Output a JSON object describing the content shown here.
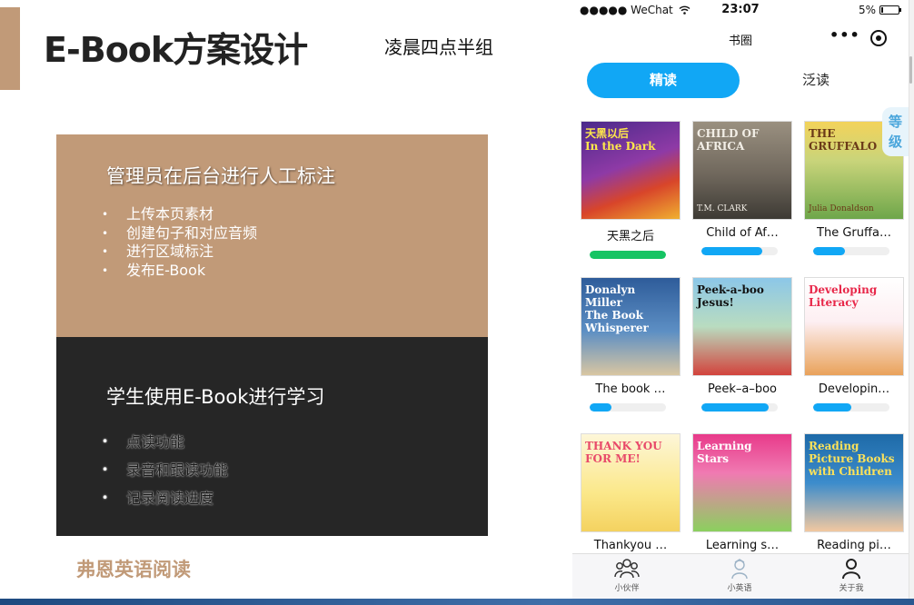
{
  "slide": {
    "title": "E-Book方案设计",
    "team": "凌晨四点半组",
    "admin_panel": {
      "heading": "管理员在后台进行人工标注",
      "items": [
        "上传本页素材",
        "创建句子和对应音频",
        "进行区域标注",
        "发布E-Book"
      ]
    },
    "student_panel": {
      "heading": "学生使用E-Book进行学习",
      "items": [
        "点读功能",
        "录音和跟读功能",
        "记录阅读进度"
      ]
    },
    "brand": "弗恩英语阅读",
    "accent_color": "#c19a78",
    "dark_color": "#262626"
  },
  "phone": {
    "status": {
      "carrier": "●●●●● WeChat",
      "time": "23:07",
      "battery": "5%"
    },
    "nav_title": "书圈",
    "more_glyph": "•••",
    "tabs": {
      "active": "精读",
      "inactive": "泛读"
    },
    "grade_tag": "等级",
    "accent_color": "#11a7f5",
    "books": [
      {
        "title": "天黑之后",
        "progress": 1.0,
        "progress_color": "#16c463",
        "cover": {
          "bg": "linear-gradient(160deg,#4a2a8a 0%,#8e3aa6 45%,#d8452a 70%,#f0b030 100%)",
          "text": "天黑以后\nIn the Dark",
          "color": "#ffe94a",
          "sub": ""
        }
      },
      {
        "title": "Child of Af…",
        "progress": 0.8,
        "progress_color": "#11a7f5",
        "cover": {
          "bg": "linear-gradient(180deg,#9a9080 0%,#6f675c 55%,#3d3a34 100%)",
          "text": "CHILD OF\nAFRICA",
          "color": "#f2eee6",
          "sub": "T.M. CLARK"
        }
      },
      {
        "title": "The Gruffa…",
        "progress": 0.42,
        "progress_color": "#11a7f5",
        "cover": {
          "bg": "linear-gradient(180deg,#f3d35a 0%,#c9d47a 40%,#6ea64a 100%)",
          "text": "THE\nGRUFFALO",
          "color": "#6b3a18",
          "sub": "Julia Donaldson"
        }
      },
      {
        "title": "The book …",
        "progress": 0.28,
        "progress_color": "#11a7f5",
        "cover": {
          "bg": "linear-gradient(180deg,#2e5c9a 0%,#5d8fc4 55%,#d9c6a2 100%)",
          "text": "Donalyn Miller\nThe Book\nWhisperer",
          "color": "#ffffff",
          "sub": ""
        }
      },
      {
        "title": "Peek–a–boo",
        "progress": 0.88,
        "progress_color": "#11a7f5",
        "cover": {
          "bg": "linear-gradient(180deg,#8cc7e8 0%,#b9dcc0 50%,#d2433c 100%)",
          "text": "Peek-a-boo\nJesus!",
          "color": "#111111",
          "sub": ""
        }
      },
      {
        "title": "Developin…",
        "progress": 0.5,
        "progress_color": "#11a7f5",
        "cover": {
          "bg": "linear-gradient(180deg,#ffffff 0%,#fdeff2 45%,#e9a25a 100%)",
          "text": "Developing\nLiteracy",
          "color": "#e8284a",
          "sub": ""
        }
      },
      {
        "title": "Thankyou …",
        "progress": 0,
        "progress_color": "#11a7f5",
        "cover": {
          "bg": "linear-gradient(180deg,#fdf6d8 0%,#fbe88a 60%,#f4d260 100%)",
          "text": "THANK YOU\nFOR ME!",
          "color": "#e84a6a",
          "sub": ""
        }
      },
      {
        "title": "Learning s…",
        "progress": 0,
        "progress_color": "#11a7f5",
        "cover": {
          "bg": "linear-gradient(180deg,#e83a8a 0%,#f07ab2 40%,#8bd05e 100%)",
          "text": "Learning\nStars",
          "color": "#ffffff",
          "sub": ""
        }
      },
      {
        "title": "Reading pi…",
        "progress": 0,
        "progress_color": "#11a7f5",
        "cover": {
          "bg": "linear-gradient(180deg,#1e6aa8 0%,#3c8ccc 50%,#f2c8a0 100%)",
          "text": "Reading\nPicture Books\nwith Children",
          "color": "#fde25a",
          "sub": ""
        }
      }
    ],
    "tabbar": [
      {
        "label": "小伙伴",
        "icon": "group-icon"
      },
      {
        "label": "小英语",
        "icon": "student-icon"
      },
      {
        "label": "关于我",
        "icon": "person-icon"
      }
    ]
  }
}
